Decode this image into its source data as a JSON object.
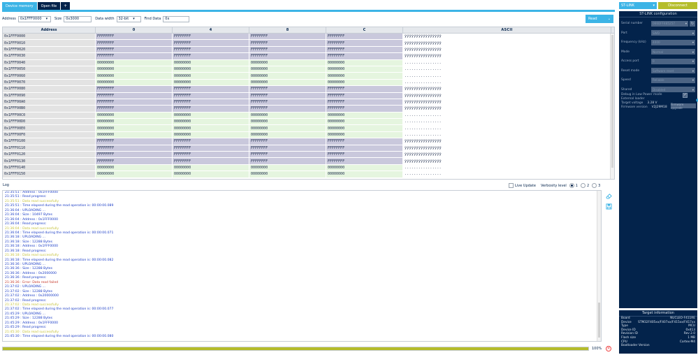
{
  "tabs": [
    {
      "label": "Device memory",
      "active": true
    },
    {
      "label": "Open file",
      "active": false
    },
    {
      "label": "+",
      "active": false
    }
  ],
  "toolbar": {
    "address_label": "Address",
    "address_value": "0x1FFF0000",
    "size_label": "Size",
    "size_value": "0x3000",
    "data_width_label": "Data width",
    "data_width_value": "32-bit",
    "find_label": "Find Data",
    "find_value": "0x",
    "read_label": "Read"
  },
  "grid": {
    "headers": [
      "Address",
      "0",
      "4",
      "8",
      "C",
      "ASCII"
    ],
    "rows": [
      {
        "addr": "0x1FFF0000",
        "v": [
          "FFFFFFFF",
          "FFFFFFFF",
          "FFFFFFFF",
          "FFFFFFFF"
        ],
        "ascii": "ÿÿÿÿÿÿÿÿÿÿÿÿÿÿÿÿ",
        "kind": "ff"
      },
      {
        "addr": "0x1FFF0010",
        "v": [
          "FFFFFFFF",
          "FFFFFFFF",
          "FFFFFFFF",
          "FFFFFFFF"
        ],
        "ascii": "ÿÿÿÿÿÿÿÿÿÿÿÿÿÿÿÿ",
        "kind": "ff"
      },
      {
        "addr": "0x1FFF0020",
        "v": [
          "FFFFFFFF",
          "FFFFFFFF",
          "FFFFFFFF",
          "FFFFFFFF"
        ],
        "ascii": "ÿÿÿÿÿÿÿÿÿÿÿÿÿÿÿÿ",
        "kind": "ff"
      },
      {
        "addr": "0x1FFF0030",
        "v": [
          "FFFFFFFF",
          "FFFFFFFF",
          "FFFFFFFF",
          "FFFFFFFF"
        ],
        "ascii": "ÿÿÿÿÿÿÿÿÿÿÿÿÿÿÿÿ",
        "kind": "ff"
      },
      {
        "addr": "0x1FFF0040",
        "v": [
          "00000000",
          "00000000",
          "00000000",
          "00000000"
        ],
        "ascii": "................",
        "kind": "zz"
      },
      {
        "addr": "0x1FFF0050",
        "v": [
          "00000000",
          "00000000",
          "00000000",
          "00000000"
        ],
        "ascii": "................",
        "kind": "zz"
      },
      {
        "addr": "0x1FFF0060",
        "v": [
          "00000000",
          "00000000",
          "00000000",
          "00000000"
        ],
        "ascii": "................",
        "kind": "zz"
      },
      {
        "addr": "0x1FFF0070",
        "v": [
          "00000000",
          "00000000",
          "00000000",
          "00000000"
        ],
        "ascii": "................",
        "kind": "zz"
      },
      {
        "addr": "0x1FFF0080",
        "v": [
          "FFFFFFFF",
          "FFFFFFFF",
          "FFFFFFFF",
          "FFFFFFFF"
        ],
        "ascii": "ÿÿÿÿÿÿÿÿÿÿÿÿÿÿÿÿ",
        "kind": "ff"
      },
      {
        "addr": "0x1FFF0090",
        "v": [
          "FFFFFFFF",
          "FFFFFFFF",
          "FFFFFFFF",
          "FFFFFFFF"
        ],
        "ascii": "ÿÿÿÿÿÿÿÿÿÿÿÿÿÿÿÿ",
        "kind": "ff"
      },
      {
        "addr": "0x1FFF00A0",
        "v": [
          "FFFFFFFF",
          "FFFFFFFF",
          "FFFFFFFF",
          "FFFFFFFF"
        ],
        "ascii": "ÿÿÿÿÿÿÿÿÿÿÿÿÿÿÿÿ",
        "kind": "ff"
      },
      {
        "addr": "0x1FFF00B0",
        "v": [
          "FFFFFFFF",
          "FFFFFFFF",
          "FFFFFFFF",
          "FFFFFFFF"
        ],
        "ascii": "ÿÿÿÿÿÿÿÿÿÿÿÿÿÿÿÿ",
        "kind": "ff"
      },
      {
        "addr": "0x1FFF00C0",
        "v": [
          "00000000",
          "00000000",
          "00000000",
          "00000000"
        ],
        "ascii": "................",
        "kind": "zz"
      },
      {
        "addr": "0x1FFF00D0",
        "v": [
          "00000000",
          "00000000",
          "00000000",
          "00000000"
        ],
        "ascii": "................",
        "kind": "zz"
      },
      {
        "addr": "0x1FFF00E0",
        "v": [
          "00000000",
          "00000000",
          "00000000",
          "00000000"
        ],
        "ascii": "................",
        "kind": "zz"
      },
      {
        "addr": "0x1FFF00F0",
        "v": [
          "00000000",
          "00000000",
          "00000000",
          "00000000"
        ],
        "ascii": "................",
        "kind": "zz"
      },
      {
        "addr": "0x1FFF0100",
        "v": [
          "FFFFFFFF",
          "FFFFFFFF",
          "FFFFFFFF",
          "FFFFFFFF"
        ],
        "ascii": "ÿÿÿÿÿÿÿÿÿÿÿÿÿÿÿÿ",
        "kind": "ff"
      },
      {
        "addr": "0x1FFF0110",
        "v": [
          "FFFFFFFF",
          "FFFFFFFF",
          "FFFFFFFF",
          "FFFFFFFF"
        ],
        "ascii": "ÿÿÿÿÿÿÿÿÿÿÿÿÿÿÿÿ",
        "kind": "ff"
      },
      {
        "addr": "0x1FFF0120",
        "v": [
          "FFFFFFFF",
          "FFFFFFFF",
          "FFFFFFFF",
          "FFFFFFFF"
        ],
        "ascii": "ÿÿÿÿÿÿÿÿÿÿÿÿÿÿÿÿ",
        "kind": "ff"
      },
      {
        "addr": "0x1FFF0130",
        "v": [
          "FFFFFFFF",
          "FFFFFFFF",
          "FFFFFFFF",
          "FFFFFFFF"
        ],
        "ascii": "ÿÿÿÿÿÿÿÿÿÿÿÿÿÿÿÿ",
        "kind": "ff"
      },
      {
        "addr": "0x1FFF0140",
        "v": [
          "00000000",
          "00000000",
          "00000000",
          "00000000"
        ],
        "ascii": "................",
        "kind": "zz"
      },
      {
        "addr": "0x1FFF0150",
        "v": [
          "00000000",
          "00000000",
          "00000000",
          "00000000"
        ],
        "ascii": "................",
        "kind": "zz"
      }
    ]
  },
  "log": {
    "title": "Log",
    "live_update_label": "Live Update",
    "verbosity_label": "Verbosity level",
    "verbosity_options": [
      "1",
      "2",
      "3"
    ],
    "verbosity_selected": "1",
    "lines": [
      {
        "t": "21:35:51 :   Address        : 0x1FFF0000",
        "k": "i"
      },
      {
        "t": "21:35:51 : Read progress:",
        "k": "i"
      },
      {
        "t": "21:35:51 : Data read successfully",
        "k": "s"
      },
      {
        "t": "21:35:51 : Time elapsed during the read operation is: 00:00:00.089",
        "k": "i"
      },
      {
        "t": "21:36:04 : UPLOADING ...",
        "k": "i"
      },
      {
        "t": "21:36:04 :   Size           : 10497 Bytes",
        "k": "i"
      },
      {
        "t": "21:36:04 :   Address        : 0x1FFF0000",
        "k": "i"
      },
      {
        "t": "21:36:04 : Read progress:",
        "k": "i"
      },
      {
        "t": "21:36:04 : Data read successfully",
        "k": "s"
      },
      {
        "t": "21:36:04 : Time elapsed during the read operation is: 00:00:00.071",
        "k": "i"
      },
      {
        "t": "21:36:18 : UPLOADING ...",
        "k": "i"
      },
      {
        "t": "21:36:18 :   Size           : 12288 Bytes",
        "k": "i"
      },
      {
        "t": "21:36:18 :   Address        : 0x1FFF0000",
        "k": "i"
      },
      {
        "t": "21:36:18 : Read progress:",
        "k": "i"
      },
      {
        "t": "21:36:18 : Data read successfully",
        "k": "s"
      },
      {
        "t": "21:36:18 : Time elapsed during the read operation is: 00:00:00.082",
        "k": "i"
      },
      {
        "t": "21:36:36 : UPLOADING ...",
        "k": "i"
      },
      {
        "t": "21:36:36 :   Size           : 12288 Bytes",
        "k": "i"
      },
      {
        "t": "21:36:36 :   Address        : 0x2000000",
        "k": "i"
      },
      {
        "t": "21:36:36 : Read progress:",
        "k": "i"
      },
      {
        "t": "21:36:36 : Error: Data read failed",
        "k": "e"
      },
      {
        "t": "21:37:02 : UPLOADING ...",
        "k": "i"
      },
      {
        "t": "21:37:02 :   Size           : 12288 Bytes",
        "k": "i"
      },
      {
        "t": "21:37:02 :   Address        : 0x20000000",
        "k": "i"
      },
      {
        "t": "21:37:02 : Read progress:",
        "k": "i"
      },
      {
        "t": "21:37:02 : Data read successfully",
        "k": "s"
      },
      {
        "t": "21:37:02 : Time elapsed during the read operation is: 00:00:00.077",
        "k": "i"
      },
      {
        "t": "21:45:29 : UPLOADING ...",
        "k": "i"
      },
      {
        "t": "21:45:29 :   Size           : 12288 Bytes",
        "k": "i"
      },
      {
        "t": "21:45:29 :   Address        : 0x1FFF0000",
        "k": "i"
      },
      {
        "t": "21:45:29 : Read progress:",
        "k": "i"
      },
      {
        "t": "21:45:30 : Data read successfully",
        "k": "s"
      },
      {
        "t": "21:45:30 : Time elapsed during the read operation is: 00:00:00.080",
        "k": "i"
      }
    ]
  },
  "progress": {
    "value": 1.0,
    "label": "100%"
  },
  "right": {
    "probe_label": "ST-LINK",
    "disconnect_label": "Disconnect",
    "config_title": "ST-LINK configuration",
    "fields": [
      {
        "k": "Serial number",
        "v": "066DFF485257"
      },
      {
        "k": "Port",
        "v": "SWD"
      },
      {
        "k": "Frequency (kHz)",
        "v": "4000"
      },
      {
        "k": "Mode",
        "v": "Normal"
      },
      {
        "k": "Access port",
        "v": "0"
      },
      {
        "k": "Reset mode",
        "v": "Software reset"
      },
      {
        "k": "Speed",
        "v": "Reliable"
      },
      {
        "k": "Shared",
        "v": "Disabled"
      }
    ],
    "debug_low_power": "Debug in Low Power mode",
    "external_loader": "External loader",
    "target_voltage_label": "Target voltage",
    "target_voltage_value": "3.28 V",
    "firmware_label": "Firmware version",
    "firmware_value": "V2J29M18",
    "firmware_upgrade": "Firmware upgrade",
    "target_info_title": "Target information",
    "target_info": [
      {
        "k": "Board",
        "v": "NUCLEO-F411RE"
      },
      {
        "k": "Device",
        "v": "STM32F405xx/F407xx/F415xx/F417xx"
      },
      {
        "k": "Type",
        "v": "MCU"
      },
      {
        "k": "Device ID",
        "v": "0x413"
      },
      {
        "k": "Revision ID",
        "v": "Rev 2.0"
      },
      {
        "k": "Flash size",
        "v": "1 MB"
      },
      {
        "k": "CPU",
        "v": "Cortex-M4"
      },
      {
        "k": "Bootloader Version",
        "v": ""
      }
    ]
  },
  "colors": {
    "accent": "#3cb4e6",
    "navy": "#03234b",
    "lime": "#b5bd2b",
    "ff_cell": "#c9c8dc",
    "zero_cell": "#e5f5df"
  }
}
